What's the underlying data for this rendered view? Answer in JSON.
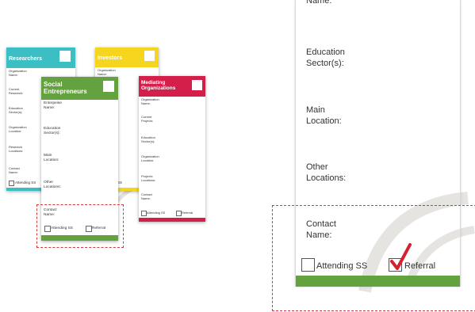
{
  "colors": {
    "teal": "#3bbec4",
    "yellow": "#f5d51e",
    "green": "#63a23f",
    "crimson": "#d51f4b",
    "dashed": "#d23b3b",
    "check": "#d6202d",
    "watermark": "#e4e2df"
  },
  "researchers": {
    "title": "Researchers",
    "fields": [
      "Organization\nName:",
      "Current\nResearch:",
      "Education\nSector(s):",
      "Organization\nLocation:",
      "Research\nLocations:",
      "Contact\nName:"
    ],
    "attending": "Attending SS"
  },
  "investors": {
    "title": "Investors",
    "fields": [
      "Organization\nName:"
    ],
    "partial": "SS"
  },
  "social": {
    "title": "Social\nEntrepreneurs",
    "fields": [
      "Enterpeise\nName:",
      "Education\nSector(s):",
      "Main\nLocation:",
      "Other\nLocations:",
      "Contact\nName:"
    ],
    "attending": "Attending SS",
    "referral": "Referral"
  },
  "mediating": {
    "title": "Mediating\nOrganizations",
    "fields": [
      "Organization\nName:",
      "Current\nProjects",
      "Education\nSector(s):",
      "Organization\nLocation:",
      "Projects\nLocations:",
      "Contact\nName:"
    ],
    "attending": "Attending SS",
    "referral": "Referral"
  },
  "zoom": {
    "top_partial": "Name:",
    "fields": [
      "Education\nSector(s):",
      "Main\nLocation:",
      "Other\nLocations:",
      "Contact\nName:"
    ],
    "attending": "Attending SS",
    "referral": "Referral",
    "icons": [
      "checkbox-icon",
      "checkmark-icon",
      "leaf-watermark-icon"
    ]
  }
}
